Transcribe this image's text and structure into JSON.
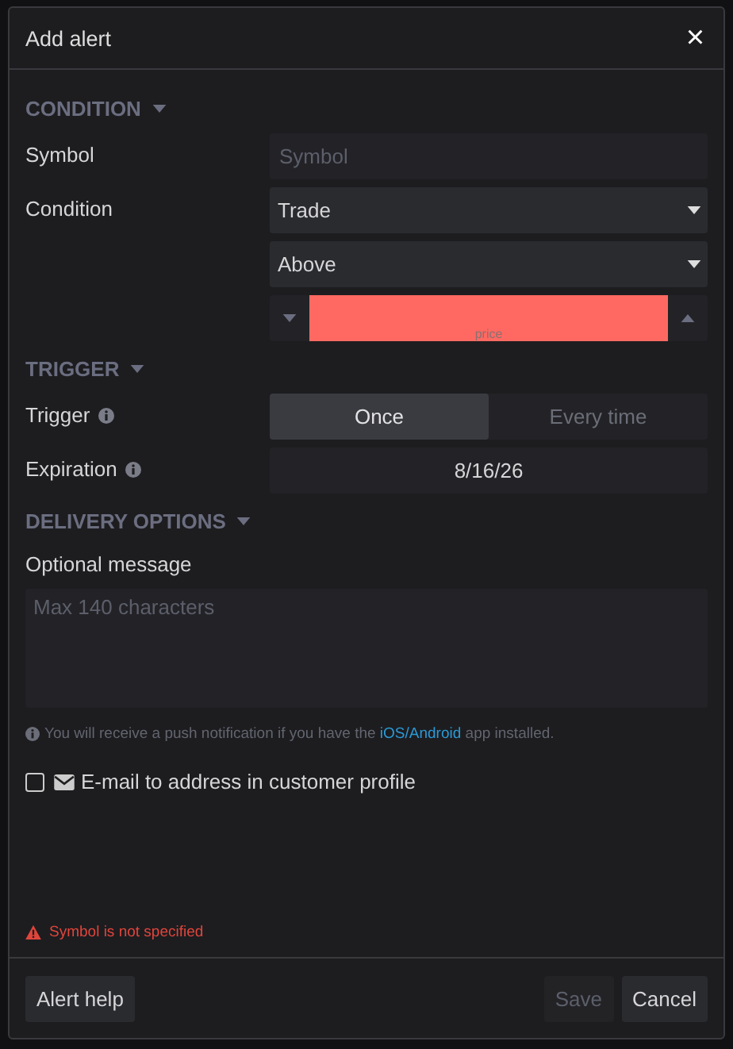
{
  "dialog": {
    "title": "Add alert",
    "close": "×"
  },
  "sections": [
    {
      "heading": "CONDITION"
    },
    {
      "heading": "TRIGGER"
    },
    {
      "heading": "DELIVERY OPTIONS"
    }
  ],
  "symbol": {
    "label": "Symbol",
    "placeholder": "Symbol"
  },
  "condition": {
    "label": "Condition",
    "type": "Trade",
    "direction": "Above",
    "price_placeholder": "price",
    "price_invalid": true
  },
  "trigger": {
    "label": "Trigger",
    "options": [
      {
        "label": "Once",
        "selected": true
      },
      {
        "label": "Every time",
        "selected": false
      }
    ]
  },
  "expiration": {
    "label": "Expiration",
    "value": "8/16/26"
  },
  "message": {
    "label": "Optional message",
    "placeholder": "Max 140 characters"
  },
  "push_note": {
    "before": "You will receive a push notification if you have the",
    "link": "iOS/Android",
    "after": "app installed."
  },
  "email": {
    "label": "E-mail to address in customer profile",
    "checked": false
  },
  "error": "Symbol is not specified",
  "footer": {
    "help": "Alert help",
    "save": {
      "label": "Save",
      "disabled": true
    },
    "cancel": "Cancel"
  }
}
